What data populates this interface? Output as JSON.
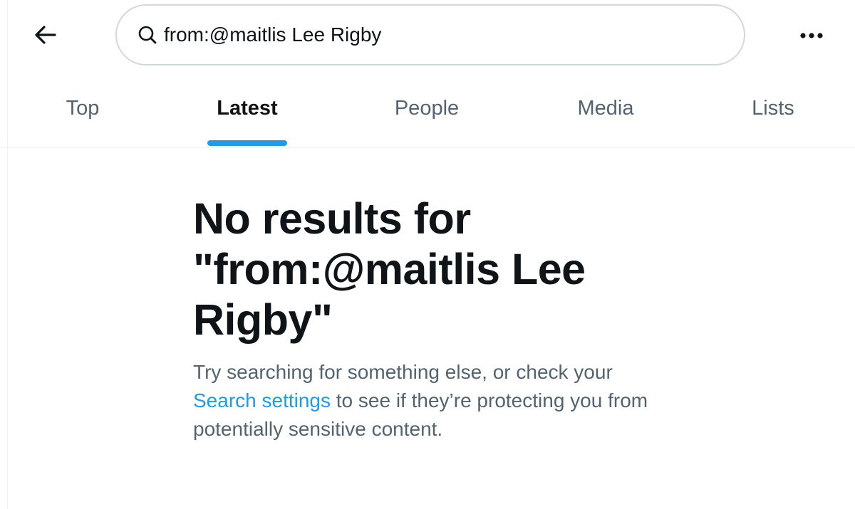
{
  "header": {
    "back_icon": "arrow-left-icon",
    "search": {
      "icon": "search-icon",
      "value": "from:@maitlis Lee Rigby",
      "placeholder": "Search"
    },
    "more_icon": "more-horizontal-icon"
  },
  "tabs": [
    {
      "label": "Top",
      "active": false
    },
    {
      "label": "Latest",
      "active": true
    },
    {
      "label": "People",
      "active": false
    },
    {
      "label": "Media",
      "active": false
    },
    {
      "label": "Lists",
      "active": false
    }
  ],
  "empty_state": {
    "title": "No results for \"from:@maitlis Lee Rigby\"",
    "desc_before": "Try searching for something else, or check your ",
    "link_text": "Search settings",
    "desc_after": " to see if they’re protecting you from potentially sensitive content."
  },
  "colors": {
    "accent": "#1d9bf0",
    "text_primary": "#0f1419",
    "text_secondary": "#536471",
    "border": "#cfd9de",
    "divider": "#eff3f4"
  }
}
